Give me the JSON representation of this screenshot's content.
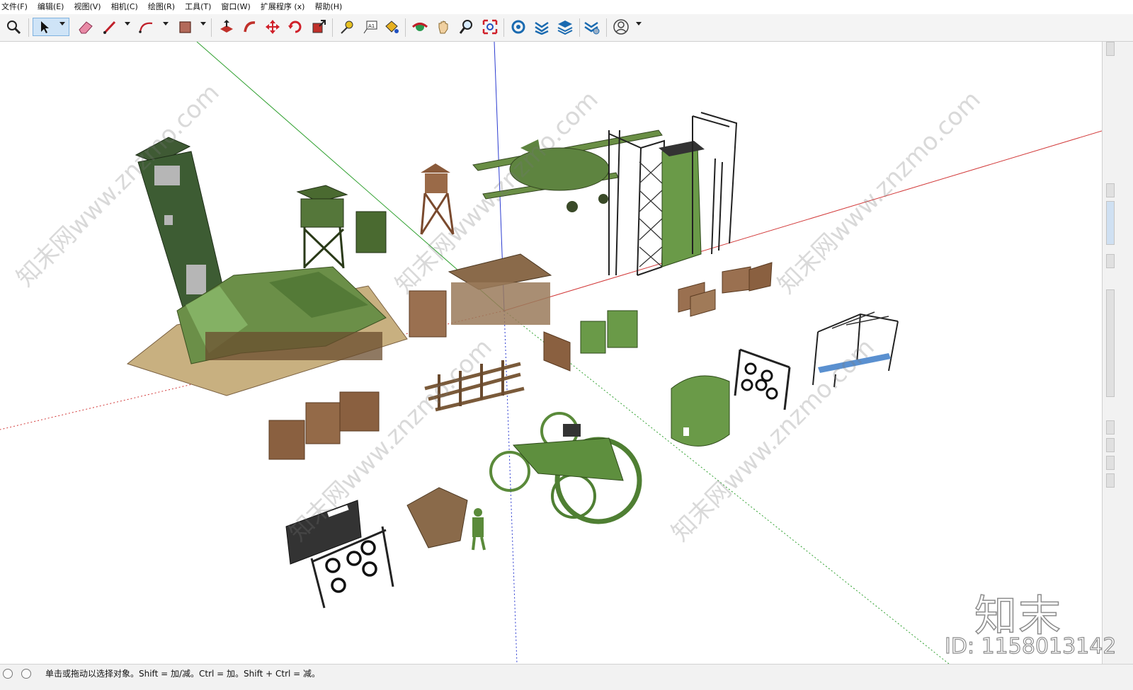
{
  "menu": {
    "items": [
      {
        "label": "文件(F)"
      },
      {
        "label": "编辑(E)"
      },
      {
        "label": "视图(V)"
      },
      {
        "label": "相机(C)"
      },
      {
        "label": "绘图(R)"
      },
      {
        "label": "工具(T)"
      },
      {
        "label": "窗口(W)"
      },
      {
        "label": "扩展程序 (x)"
      },
      {
        "label": "帮助(H)"
      }
    ]
  },
  "toolbar": {
    "tools": [
      "zoom-icon",
      "select-icon",
      "eraser-icon",
      "pencil-icon",
      "arc-icon",
      "rectangle-icon",
      "push-pull-icon",
      "follow-me-icon",
      "move-icon",
      "rotate-icon",
      "scale-icon",
      "tape-measure-icon",
      "text-icon",
      "paint-bucket-icon",
      "orbit-icon",
      "pan-icon",
      "zoom-tool-icon",
      "zoom-extents-icon",
      "warehouse-icon",
      "extension-icon",
      "layers-icon",
      "styles-icon",
      "account-icon"
    ],
    "selected": "select-icon"
  },
  "colors": {
    "axis_red": "#d23a3a",
    "axis_green": "#2fa02f",
    "axis_blue": "#2b3bd0",
    "camo_green": "#5a7a3a",
    "wood_brown": "#8a6a4a"
  },
  "viewport": {
    "watermark_diagonal": "知末网www.znzmo.com",
    "watermark_logo": "知末",
    "watermark_id": "ID: 1158013142"
  },
  "status": {
    "hint": "单击或拖动以选择对象。Shift = 加/减。Ctrl = 加。Shift + Ctrl = 减。"
  }
}
